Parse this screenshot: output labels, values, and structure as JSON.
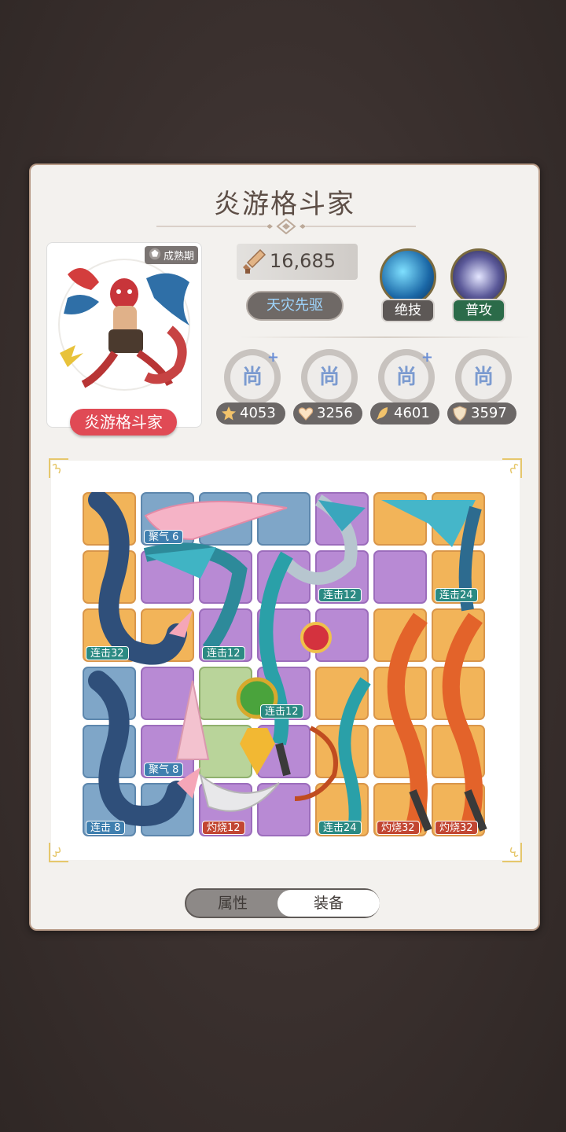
{
  "character": {
    "name_title": "炎游格斗家",
    "name_badge": "炎游格斗家",
    "stage": "成熟期",
    "power": "16,685",
    "title_tag": "天灾先驱"
  },
  "skills": [
    {
      "label": "绝技",
      "icon": "water-swirl-icon"
    },
    {
      "label": "普攻",
      "icon": "claw-slash-icon"
    }
  ],
  "ranks": [
    {
      "glyph": "尚",
      "plus": "+"
    },
    {
      "glyph": "尚",
      "plus": ""
    },
    {
      "glyph": "尚",
      "plus": "+"
    },
    {
      "glyph": "尚",
      "plus": ""
    }
  ],
  "stats": [
    {
      "icon": "star-icon",
      "value": "4053"
    },
    {
      "icon": "heart-icon",
      "value": "3256"
    },
    {
      "icon": "feather-icon",
      "value": "4601"
    },
    {
      "icon": "shield-icon",
      "value": "3597"
    }
  ],
  "board": {
    "tags": [
      {
        "text": "聚气 6",
        "color": "blue"
      },
      {
        "text": "连击12",
        "color": "teal"
      },
      {
        "text": "连击24",
        "color": "teal"
      },
      {
        "text": "连击32",
        "color": "teal"
      },
      {
        "text": "连击12",
        "color": "teal"
      },
      {
        "text": "连击12",
        "color": "teal"
      },
      {
        "text": "聚气 8",
        "color": "blue"
      },
      {
        "text": "连击 8",
        "color": "blue"
      },
      {
        "text": "灼烧12",
        "color": "red"
      },
      {
        "text": "连击24",
        "color": "teal"
      },
      {
        "text": "灼烧32",
        "color": "red"
      },
      {
        "text": "灼烧32",
        "color": "red"
      }
    ]
  },
  "tabs": {
    "attributes": "属性",
    "equipment": "装备"
  },
  "colors": {
    "badge": "#e04a55",
    "cell_orange": "#f2b459",
    "cell_blue": "#7fa6c8",
    "cell_purple": "#b88ad4",
    "cell_green": "#b9d49a"
  }
}
